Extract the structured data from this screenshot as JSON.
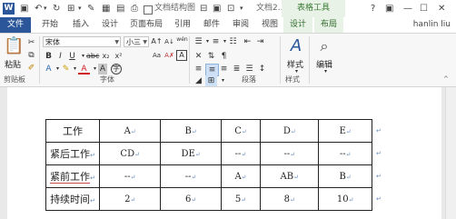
{
  "titlebar": {
    "doc_structure_label": "文档结构图",
    "doc_title": "文档2...",
    "context_title": "表格工具"
  },
  "tabs": [
    "文件",
    "开始",
    "插入",
    "设计",
    "页面布局",
    "引用",
    "邮件",
    "审阅",
    "视图"
  ],
  "context_tabs": [
    "设计",
    "布局"
  ],
  "user": "hanlin liu",
  "ribbon": {
    "paste_label": "粘贴",
    "font_name": "宋体",
    "font_size": "小三",
    "wen_char": "wén",
    "styles_label": "样式",
    "edit_label": "编辑",
    "groups": {
      "clipboard": "剪贴板",
      "font": "字体",
      "paragraph": "段落",
      "styles": "样式"
    }
  },
  "table": {
    "rows": [
      {
        "label": "工作",
        "cells": [
          "A",
          "B",
          "C",
          "D",
          "E"
        ]
      },
      {
        "label": "紧后工作",
        "cells": [
          "CD",
          "DE",
          "--",
          "--",
          "--"
        ]
      },
      {
        "label": "紧前工作",
        "cells": [
          "--",
          "--",
          "A",
          "AB",
          "B"
        ]
      },
      {
        "label": "持续时间",
        "cells": [
          "2",
          "6",
          "5",
          "8",
          "10"
        ]
      }
    ]
  }
}
